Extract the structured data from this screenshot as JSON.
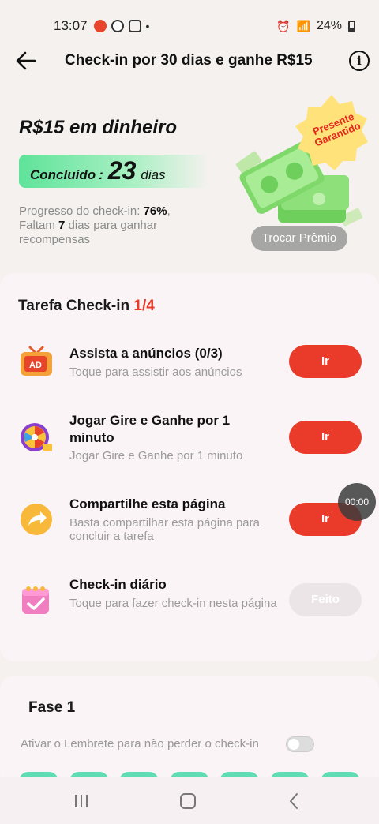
{
  "status_bar": {
    "time": "13:07",
    "network": "Vo))\nLTE2",
    "battery": "24%"
  },
  "header": {
    "title": "Check-in por 30 dias e ganhe R$15"
  },
  "hero": {
    "title": "R$15 em dinheiro",
    "done_label": "Concluído",
    "done_colon": ":",
    "done_days": "23",
    "done_unit": "dias",
    "progress_prefix": "Progresso do check-in: ",
    "progress_percent": "76%",
    "progress_mid": ",",
    "remaining_prefix": "Faltam ",
    "remaining_days": "7",
    "remaining_suffix": " dias para ganhar recompensas",
    "badge_line1": "Presente",
    "badge_line2": "Garantido",
    "exchange_button": "Trocar Prêmio"
  },
  "tasks_card": {
    "title": "Tarefa Check-in ",
    "count": "1/4",
    "tasks": [
      {
        "name": "Assista a anúncios  (0/3)",
        "sub": "Toque para assistir aos anúncios",
        "button": "Ir"
      },
      {
        "name": "Jogar Gire e Ganhe por 1 minuto",
        "sub": "Jogar Gire e Ganhe por 1 minuto",
        "button": "Ir"
      },
      {
        "name": "Compartilhe esta página",
        "sub": "Basta compartilhar esta página para concluir a tarefa",
        "button": "Ir"
      },
      {
        "name": "Check-in diário",
        "sub": "Toque para fazer check-in nesta página",
        "button": "Feito"
      }
    ],
    "timer": "00:00"
  },
  "phase_card": {
    "title": "Fase 1",
    "reminder": "Ativar o Lembrete para não perder o check-in",
    "reminder_on": false
  },
  "colors": {
    "accent_red": "#ea3b2a",
    "done_green": "#5fe39a",
    "day_pill": "#5fdcb3"
  }
}
